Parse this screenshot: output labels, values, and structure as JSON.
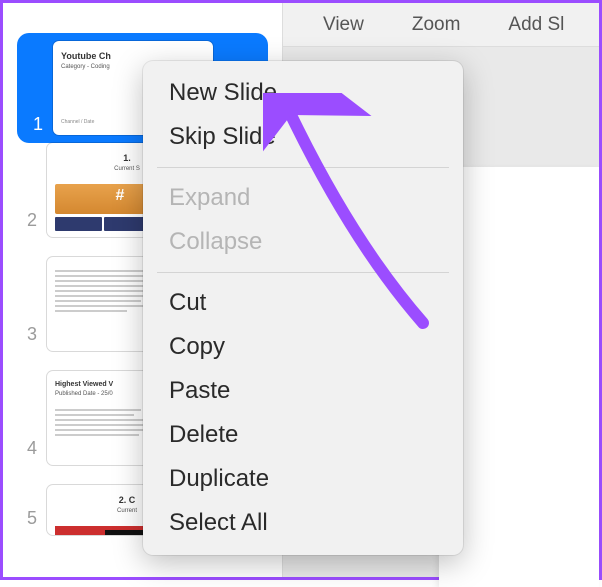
{
  "toolbar": {
    "view": "View",
    "zoom": "Zoom",
    "add_slide": "Add Sl"
  },
  "sidebar": {
    "slides": [
      {
        "num": "1",
        "title": "Youtube Ch",
        "sub": "Category - Coding",
        "foot": "Channel / Date"
      },
      {
        "num": "2",
        "title": "1.",
        "sub": "Current S"
      },
      {
        "num": "3",
        "title": "",
        "sub": ""
      },
      {
        "num": "4",
        "title": "Highest Viewed V",
        "sub": "Published Date - 25/0"
      },
      {
        "num": "5",
        "title": "2. C",
        "sub": "Current"
      }
    ]
  },
  "context_menu": {
    "items": [
      {
        "label": "New Slide",
        "enabled": true
      },
      {
        "label": "Skip Slide",
        "enabled": true
      },
      {
        "sep": true
      },
      {
        "label": "Expand",
        "enabled": false
      },
      {
        "label": "Collapse",
        "enabled": false
      },
      {
        "sep": true
      },
      {
        "label": "Cut",
        "enabled": true
      },
      {
        "label": "Copy",
        "enabled": true
      },
      {
        "label": "Paste",
        "enabled": true
      },
      {
        "label": "Delete",
        "enabled": true
      },
      {
        "label": "Duplicate",
        "enabled": true
      },
      {
        "label": "Select All",
        "enabled": true
      }
    ]
  },
  "annotation": {
    "arrow_color": "#9b4dff"
  }
}
